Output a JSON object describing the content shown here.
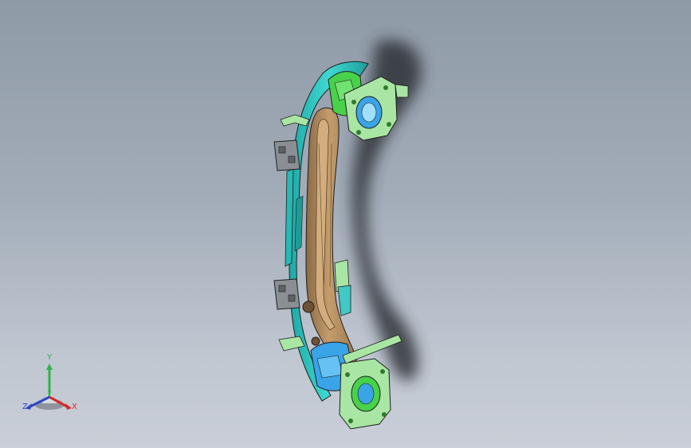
{
  "viewport": {
    "background_top": "#8f9aa7",
    "background_bottom": "#c9ced7"
  },
  "model": {
    "colors": {
      "beam": "#b38d62",
      "beam_dark": "#6f5236",
      "cyan_part": "#2ec9c4",
      "green_part": "#48d24a",
      "light_green": "#a9e6a3",
      "blue_mesh": "#3aa4e8",
      "bracket": "#8a8f93",
      "edge": "#1e1e1e",
      "shadow": "#3a3d45"
    }
  },
  "triad": {
    "y_label": "Y",
    "x_label": "X",
    "z_label": "Z",
    "y_color": "#2fb34a",
    "x_color": "#d42a2a",
    "z_color": "#2a46c8"
  }
}
